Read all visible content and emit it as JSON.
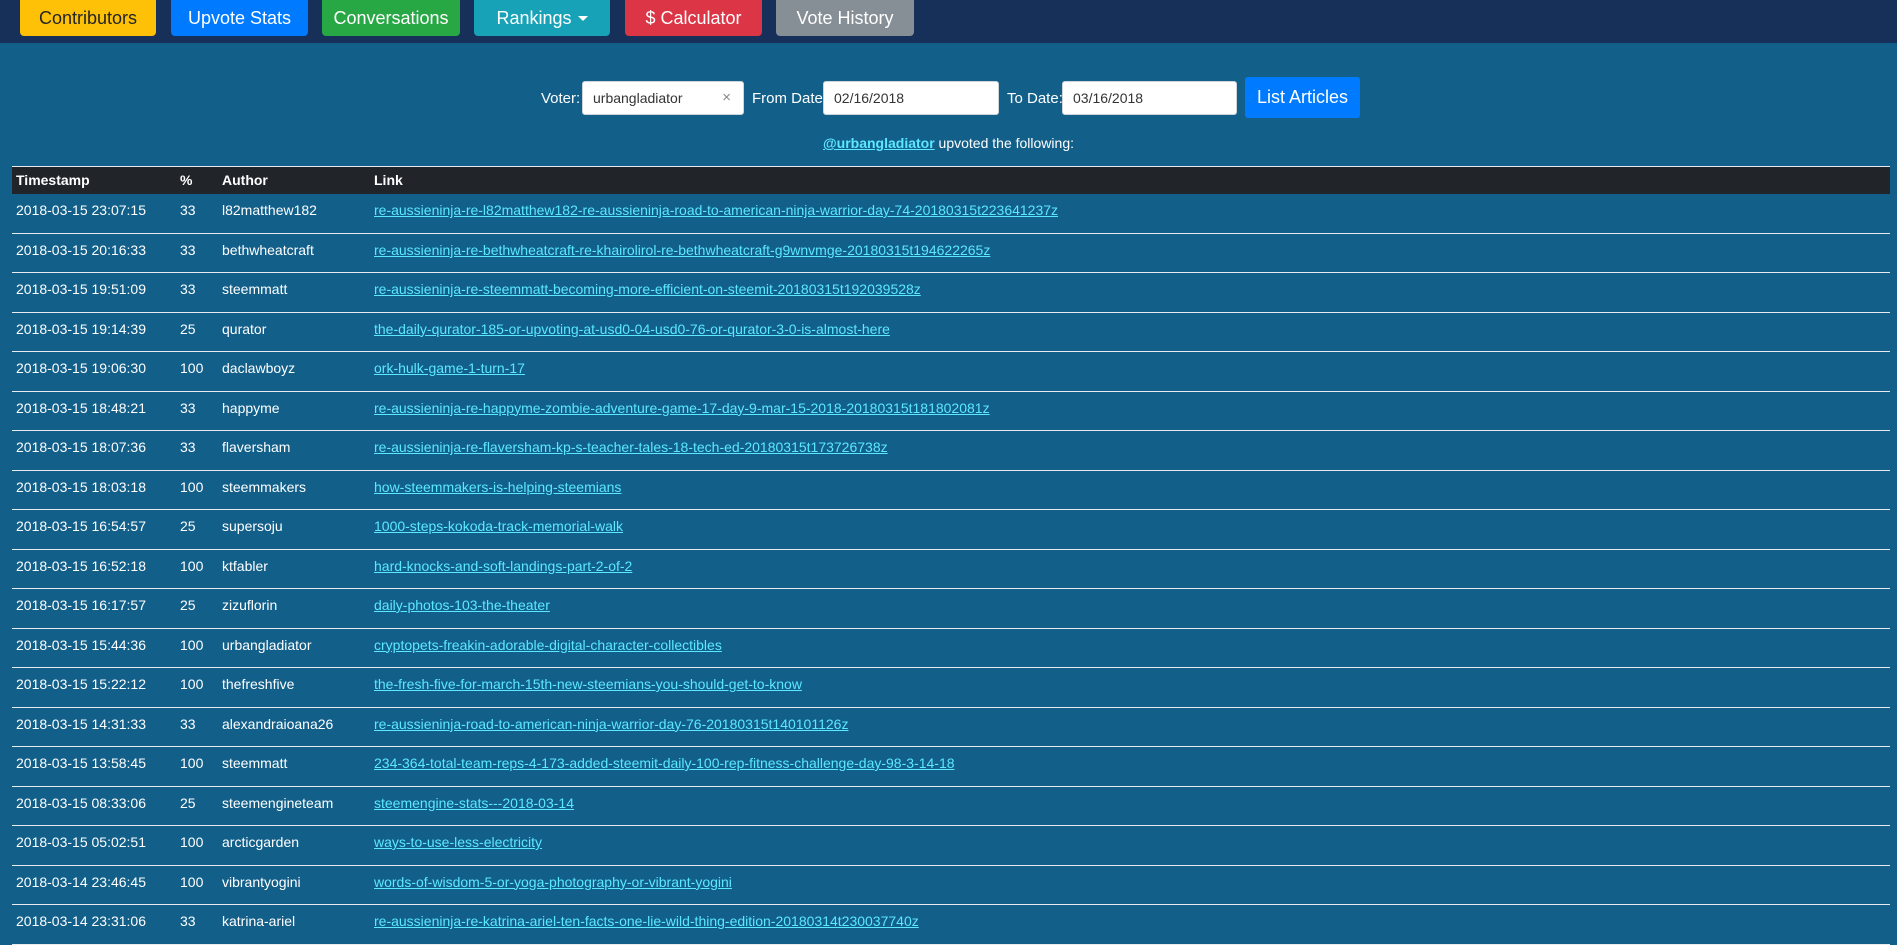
{
  "nav": {
    "contributors": "Contributors",
    "upvote_stats": "Upvote Stats",
    "conversations": "Conversations",
    "rankings": "Rankings",
    "calculator": "$ Calculator",
    "vote_history": "Vote History"
  },
  "form": {
    "voter_label": "Voter:",
    "voter_value": "urbangladiator",
    "clear_glyph": "×",
    "from_label": "From Date:",
    "from_value": "02/16/2018",
    "to_label": "To Date:",
    "to_value": "03/16/2018",
    "submit_label": "List Articles"
  },
  "heading": {
    "user": "@urbangladiator",
    "text": " upvoted the following:"
  },
  "table": {
    "headers": [
      "Timestamp",
      "%",
      "Author",
      "Link"
    ],
    "rows": [
      {
        "timestamp": "2018-03-15 23:07:15",
        "pct": "33",
        "author": "l82matthew182",
        "link": "re-aussieninja-re-l82matthew182-re-aussieninja-road-to-american-ninja-warrior-day-74-20180315t223641237z"
      },
      {
        "timestamp": "2018-03-15 20:16:33",
        "pct": "33",
        "author": "bethwheatcraft",
        "link": "re-aussieninja-re-bethwheatcraft-re-khairolirol-re-bethwheatcraft-g9wnvmge-20180315t194622265z"
      },
      {
        "timestamp": "2018-03-15 19:51:09",
        "pct": "33",
        "author": "steemmatt",
        "link": "re-aussieninja-re-steemmatt-becoming-more-efficient-on-steemit-20180315t192039528z"
      },
      {
        "timestamp": "2018-03-15 19:14:39",
        "pct": "25",
        "author": "qurator",
        "link": "the-daily-qurator-185-or-upvoting-at-usd0-04-usd0-76-or-qurator-3-0-is-almost-here"
      },
      {
        "timestamp": "2018-03-15 19:06:30",
        "pct": "100",
        "author": "daclawboyz",
        "link": "ork-hulk-game-1-turn-17"
      },
      {
        "timestamp": "2018-03-15 18:48:21",
        "pct": "33",
        "author": "happyme",
        "link": "re-aussieninja-re-happyme-zombie-adventure-game-17-day-9-mar-15-2018-20180315t181802081z"
      },
      {
        "timestamp": "2018-03-15 18:07:36",
        "pct": "33",
        "author": "flaversham",
        "link": "re-aussieninja-re-flaversham-kp-s-teacher-tales-18-tech-ed-20180315t173726738z"
      },
      {
        "timestamp": "2018-03-15 18:03:18",
        "pct": "100",
        "author": "steemmakers",
        "link": "how-steemmakers-is-helping-steemians"
      },
      {
        "timestamp": "2018-03-15 16:54:57",
        "pct": "25",
        "author": "supersoju",
        "link": "1000-steps-kokoda-track-memorial-walk"
      },
      {
        "timestamp": "2018-03-15 16:52:18",
        "pct": "100",
        "author": "ktfabler",
        "link": "hard-knocks-and-soft-landings-part-2-of-2"
      },
      {
        "timestamp": "2018-03-15 16:17:57",
        "pct": "25",
        "author": "zizuflorin",
        "link": "daily-photos-103-the-theater"
      },
      {
        "timestamp": "2018-03-15 15:44:36",
        "pct": "100",
        "author": "urbangladiator",
        "link": "cryptopets-freakin-adorable-digital-character-collectibles"
      },
      {
        "timestamp": "2018-03-15 15:22:12",
        "pct": "100",
        "author": "thefreshfive",
        "link": "the-fresh-five-for-march-15th-new-steemians-you-should-get-to-know"
      },
      {
        "timestamp": "2018-03-15 14:31:33",
        "pct": "33",
        "author": "alexandraioana26",
        "link": "re-aussieninja-road-to-american-ninja-warrior-day-76-20180315t140101126z"
      },
      {
        "timestamp": "2018-03-15 13:58:45",
        "pct": "100",
        "author": "steemmatt",
        "link": "234-364-total-team-reps-4-173-added-steemit-daily-100-rep-fitness-challenge-day-98-3-14-18"
      },
      {
        "timestamp": "2018-03-15 08:33:06",
        "pct": "25",
        "author": "steemengineteam",
        "link": "steemengine-stats---2018-03-14"
      },
      {
        "timestamp": "2018-03-15 05:02:51",
        "pct": "100",
        "author": "arcticgarden",
        "link": "ways-to-use-less-electricity"
      },
      {
        "timestamp": "2018-03-14 23:46:45",
        "pct": "100",
        "author": "vibrantyogini",
        "link": "words-of-wisdom-5-or-yoga-photography-or-vibrant-yogini"
      },
      {
        "timestamp": "2018-03-14 23:31:06",
        "pct": "33",
        "author": "katrina-ariel",
        "link": "re-aussieninja-re-katrina-ariel-ten-facts-one-lie-wild-thing-edition-20180314t230037740z"
      }
    ]
  }
}
